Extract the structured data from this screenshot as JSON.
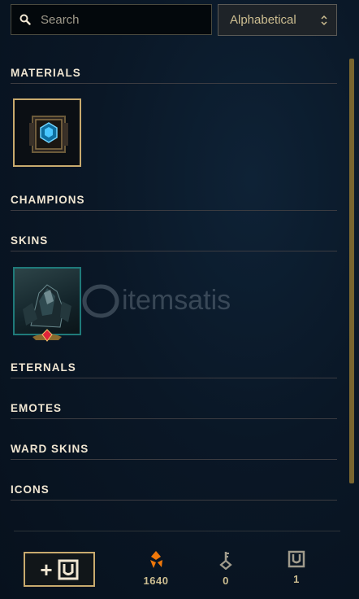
{
  "search": {
    "placeholder": "Search"
  },
  "sort": {
    "selected": "Alphabetical"
  },
  "sections": {
    "materials": "MATERIALS",
    "champions": "CHAMPIONS",
    "skins": "SKINS",
    "eternals": "ETERNALS",
    "emotes": "EMOTES",
    "ward_skins": "WARD SKINS",
    "icons": "ICONS"
  },
  "items": {
    "materials": [
      {
        "icon": "hextech-chest-icon"
      }
    ],
    "skins": [
      {
        "icon": "skin-shard-icon",
        "badge": "gem-badge-icon"
      }
    ]
  },
  "watermark": {
    "text": "itemsatis"
  },
  "footer": {
    "add_button": {
      "label": "+",
      "icon": "chest-icon"
    },
    "orange_essence": {
      "icon": "orange-essence-icon",
      "value": "1640"
    },
    "keys": {
      "icon": "key-icon",
      "value": "0"
    },
    "chests": {
      "icon": "chest-icon",
      "value": "1"
    }
  },
  "colors": {
    "gold": "#c8aa6e",
    "orange": "#f0780a",
    "text": "#cdbe91",
    "background": "#0a1726"
  }
}
